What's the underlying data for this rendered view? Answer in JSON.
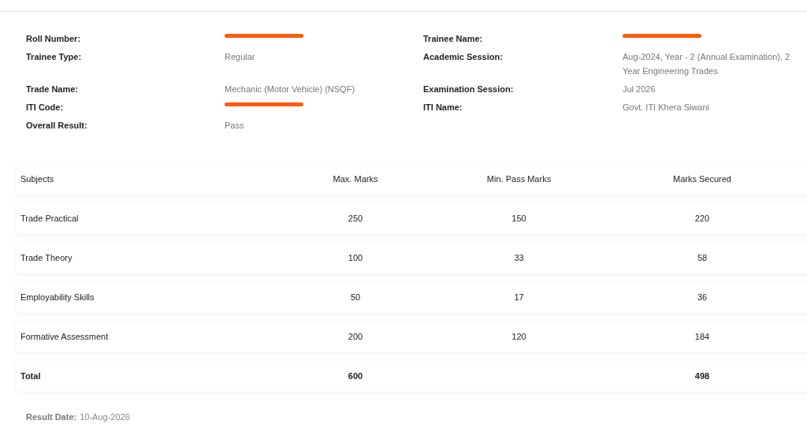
{
  "details": [
    {
      "label": "Roll Number:",
      "redacted": true
    },
    {
      "label": "Trainee Name:",
      "redacted": true
    },
    {
      "label": "Trainee Type:",
      "value": "Regular"
    },
    {
      "label": "Academic Session:",
      "value": "Aug-2024, Year - 2 (Annual Examination), 2 Year Engineering Trades"
    },
    {
      "label": "Trade Name:",
      "value": "Mechanic (Motor Vehicle) (NSQF)"
    },
    {
      "label": "Examination Session:",
      "value": "Jul 2026"
    },
    {
      "label": "ITI Code:",
      "redacted": true
    },
    {
      "label": "ITI Name:",
      "value": "Govt. ITI Khera Siwani"
    },
    {
      "label": "Overall Result:",
      "value": "Pass"
    }
  ],
  "table": {
    "columns": [
      "Subjects",
      "Max. Marks",
      "Min. Pass Marks",
      "Marks Secured"
    ],
    "rows": [
      {
        "cells": [
          "Trade Practical",
          "250",
          "150",
          "220"
        ],
        "total": false
      },
      {
        "cells": [
          "Trade Theory",
          "100",
          "33",
          "58"
        ],
        "total": false
      },
      {
        "cells": [
          "Employability Skills",
          "50",
          "17",
          "36"
        ],
        "total": false
      },
      {
        "cells": [
          "Formative Assessment",
          "200",
          "120",
          "184"
        ],
        "total": false
      },
      {
        "cells": [
          "Total",
          "600",
          "",
          "498"
        ],
        "total": true
      }
    ]
  },
  "result_date": {
    "label": "Result Date:",
    "value": "10-Aug-2026"
  }
}
